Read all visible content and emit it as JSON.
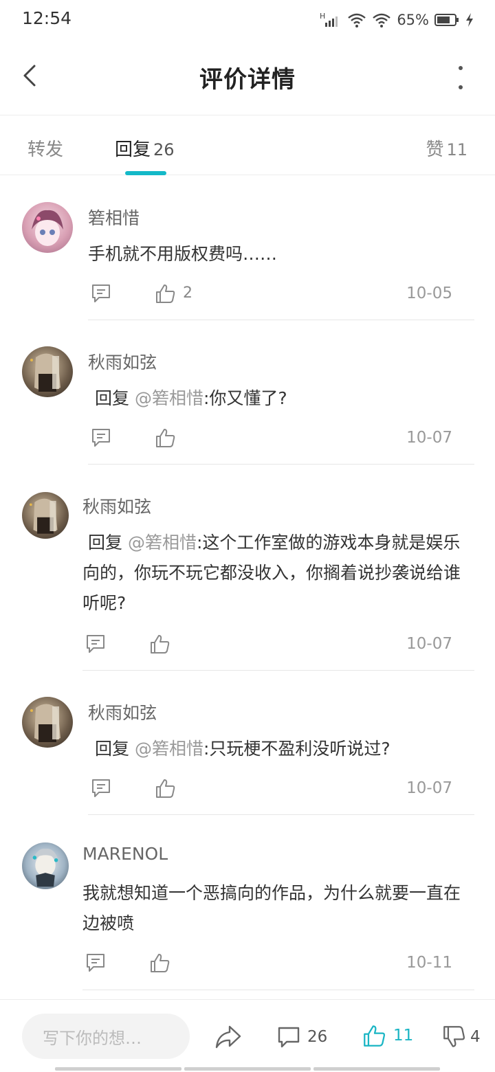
{
  "status_bar": {
    "time": "12:54",
    "network": "H",
    "battery_percent": "65%"
  },
  "header": {
    "title": "评价详情"
  },
  "tabs": {
    "repost_label": "转发",
    "reply_label": "回复",
    "reply_count": "26",
    "like_label": "赞",
    "like_count": "11",
    "active": "reply"
  },
  "comments": [
    {
      "user": "箬相惜",
      "reply_prefix": "",
      "mention": "",
      "text": "手机就不用版权费吗……",
      "likes": "2",
      "date": "10-05"
    },
    {
      "user": "秋雨如弦",
      "reply_prefix": "回复 ",
      "mention": "@箬相惜",
      "text": ":你又懂了?",
      "likes": "",
      "date": "10-07"
    },
    {
      "user": "秋雨如弦",
      "reply_prefix": "回复 ",
      "mention": "@箬相惜",
      "text": ":这个工作室做的游戏本身就是娱乐向的，你玩不玩它都没收入，你搁着说抄袭说给谁听呢?",
      "likes": "",
      "date": "10-07"
    },
    {
      "user": "秋雨如弦",
      "reply_prefix": "回复 ",
      "mention": "@箬相惜",
      "text": ":只玩梗不盈利没听说过?",
      "likes": "",
      "date": "10-07"
    },
    {
      "user": "MARENOL",
      "reply_prefix": "",
      "mention": "",
      "text": "我就想知道一个恶搞向的作品，为什么就要一直在边被喷",
      "likes": "",
      "date": "10-11"
    }
  ],
  "bottom_bar": {
    "input_placeholder": "写下你的想…",
    "comment_count": "26",
    "like_count": "11",
    "dislike_count": "4"
  },
  "colors": {
    "accent": "#14b9c8",
    "mention": "#999999",
    "text_primary": "#333333",
    "text_secondary": "#888888"
  },
  "icons": [
    "back-arrow-icon",
    "more-vertical-icon",
    "reply-icon",
    "thumbs-up-icon",
    "share-icon",
    "comment-icon",
    "thumbs-down-icon",
    "wifi-icon",
    "signal-icon",
    "battery-icon",
    "charging-icon"
  ]
}
